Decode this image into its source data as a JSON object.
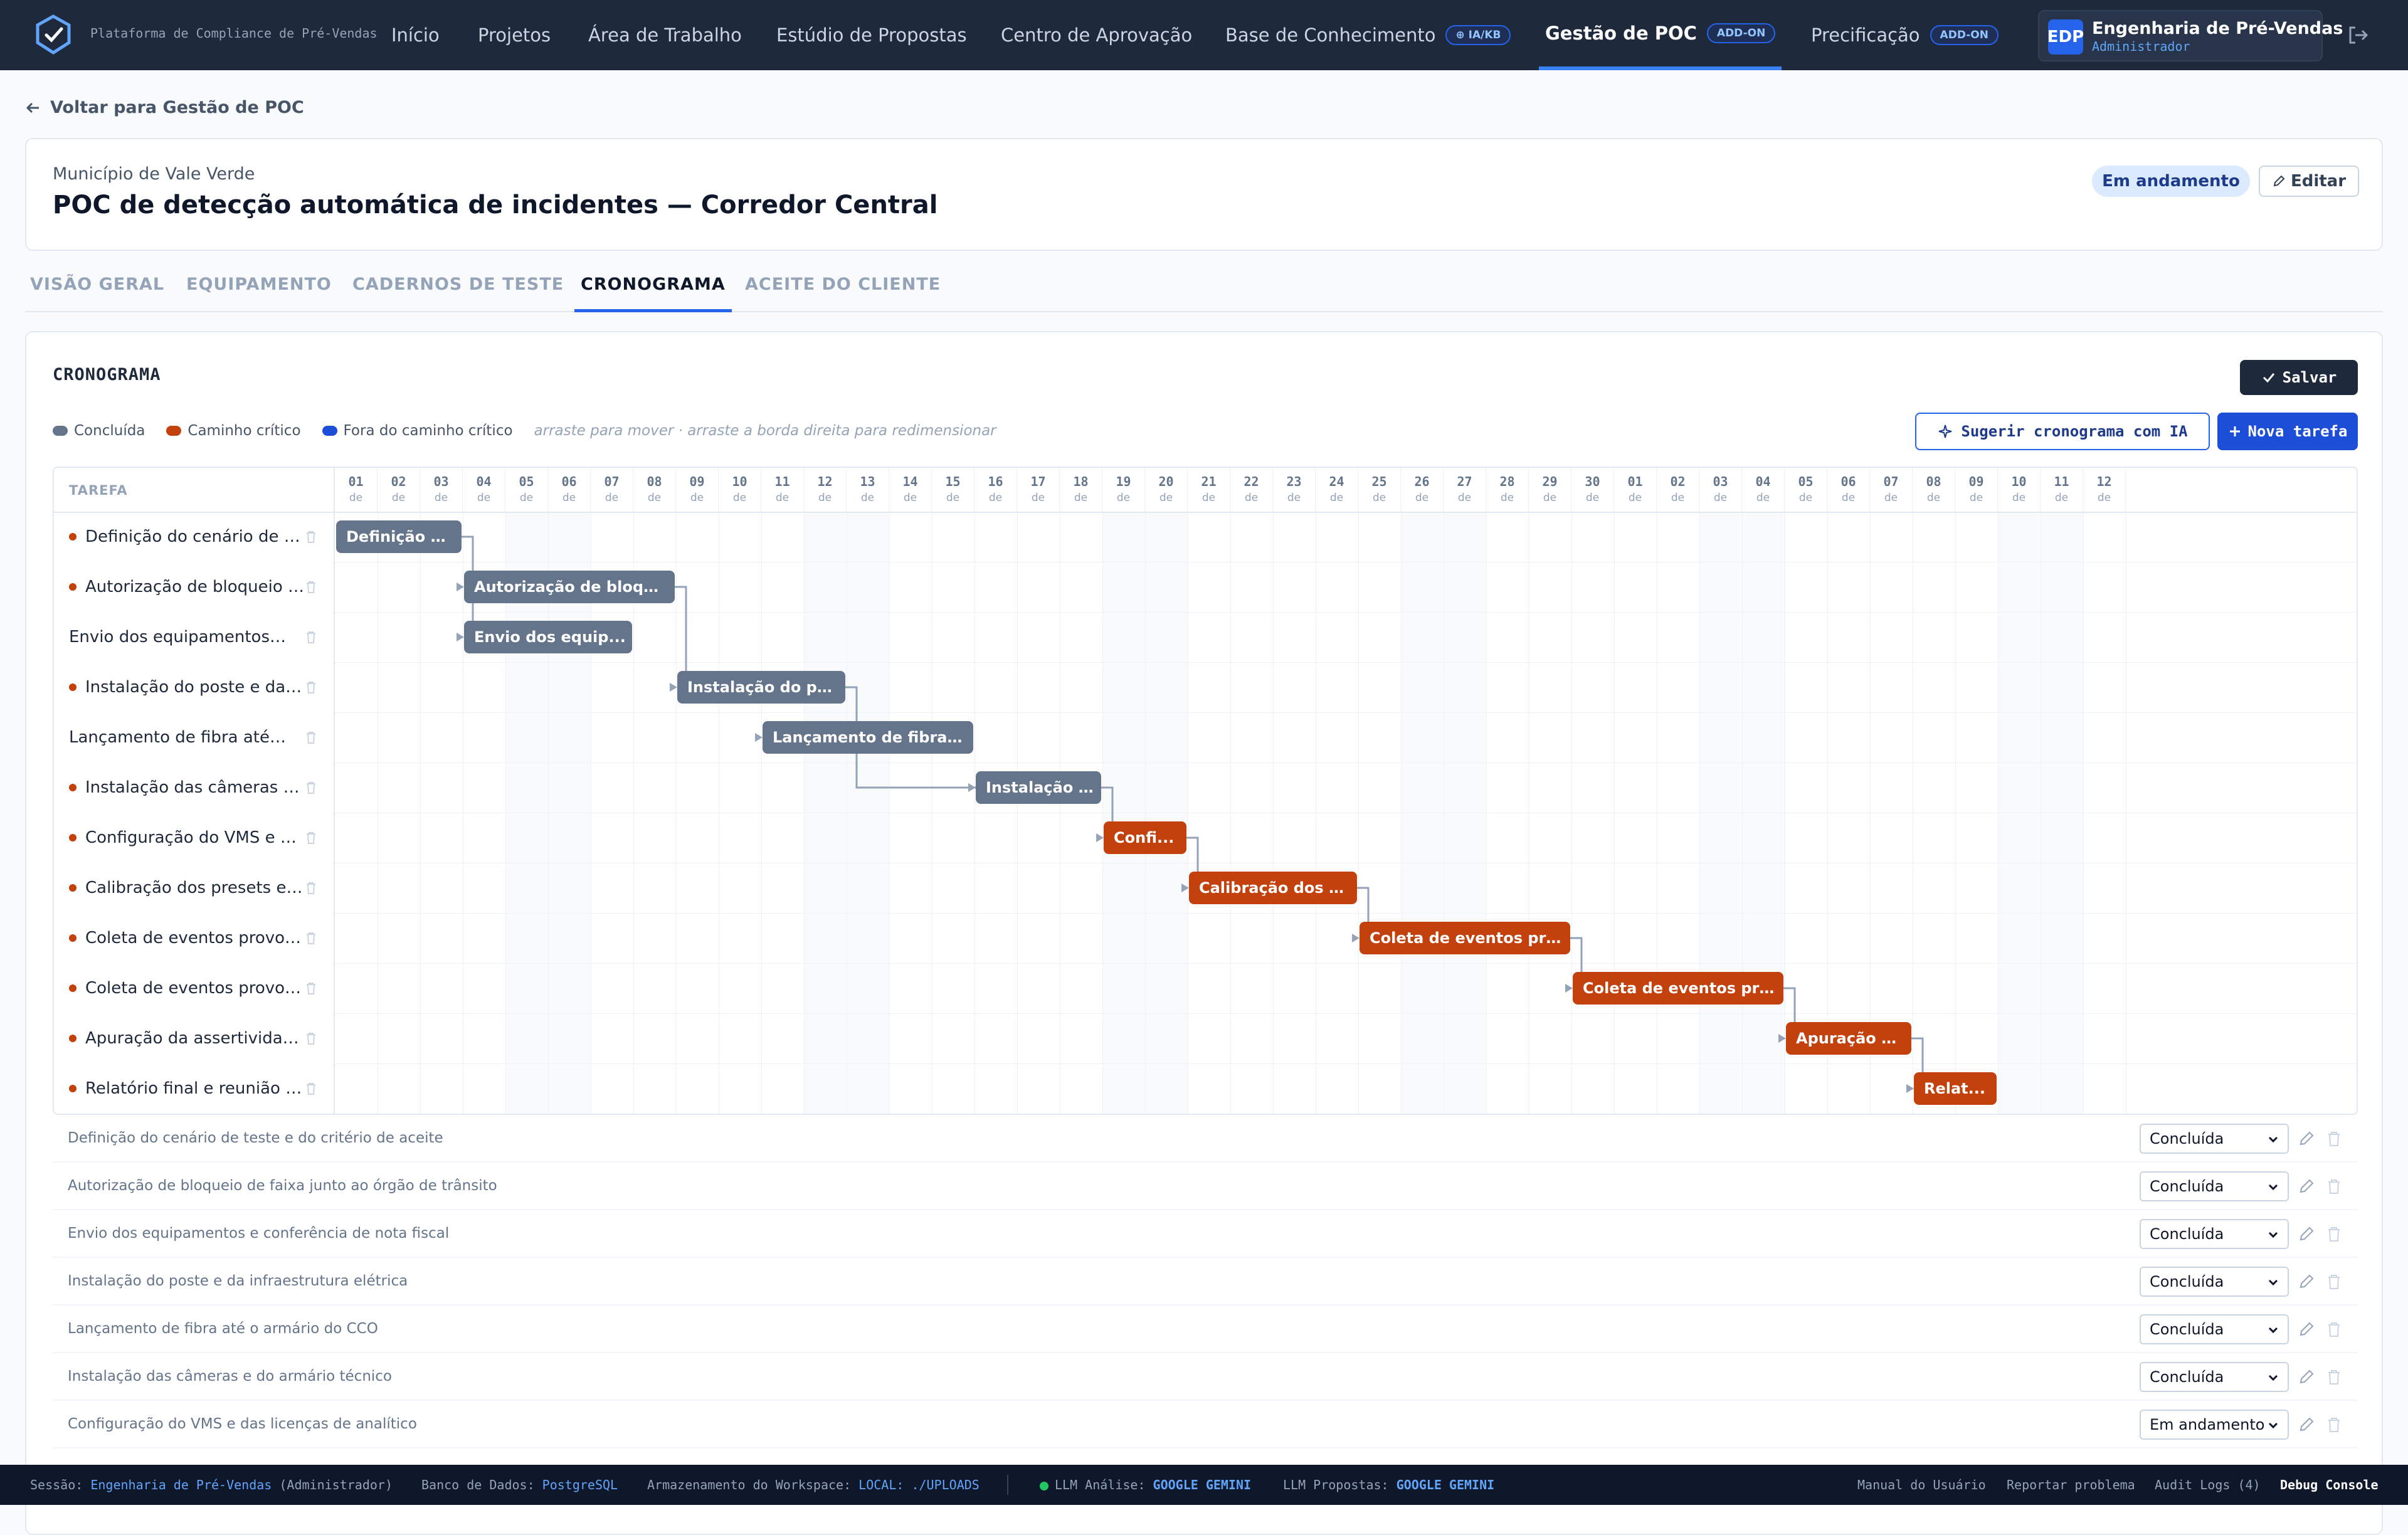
{
  "nav": {
    "brand": "Plataforma de Compliance de Pré-Vendas",
    "items": [
      {
        "label": "Início"
      },
      {
        "label": "Projetos"
      },
      {
        "label": "Área de Trabalho"
      },
      {
        "label": "Estúdio de Propostas"
      },
      {
        "label": "Centro de Aprovação"
      },
      {
        "label": "Base de Conhecimento",
        "badge": "IA/KB"
      },
      {
        "label": "Gestão de POC",
        "badge": "ADD-ON",
        "active": true
      },
      {
        "label": "Precificação",
        "badge": "ADD-ON"
      }
    ],
    "user": {
      "initials": "EDP",
      "name": "Engenharia de Pré-Vendas",
      "role": "Administrador"
    }
  },
  "back_link": "Voltar para Gestão de POC",
  "header": {
    "client": "Município de Vale Verde",
    "title": "POC de detecção automática de incidentes — Corredor Central",
    "status": "Em andamento",
    "edit_label": "Editar"
  },
  "tabs": [
    {
      "label": "VISÃO GERAL"
    },
    {
      "label": "EQUIPAMENTO"
    },
    {
      "label": "CADERNOS DE TESTE"
    },
    {
      "label": "CRONOGRAMA",
      "active": true
    },
    {
      "label": "ACEITE DO CLIENTE"
    }
  ],
  "schedule": {
    "title": "CRONOGRAMA",
    "save_label": "Salvar",
    "legend": [
      {
        "label": "Concluída",
        "color": "#64748b"
      },
      {
        "label": "Caminho crítico",
        "color": "#c2410c"
      },
      {
        "label": "Fora do caminho crítico",
        "color": "#1d4ed8"
      }
    ],
    "hint": "arraste para mover · arraste a borda direita para redimensionar",
    "ai_button": "Sugerir cronograma com IA",
    "new_button": "Nova tarefa",
    "column_header": "TAREFA",
    "day_suffix": "de",
    "days": [
      "01",
      "02",
      "03",
      "04",
      "05",
      "06",
      "07",
      "08",
      "09",
      "10",
      "11",
      "12",
      "13",
      "14",
      "15",
      "16",
      "17",
      "18",
      "19",
      "20",
      "21",
      "22",
      "23",
      "24",
      "25",
      "26",
      "27",
      "28",
      "29",
      "30",
      "01",
      "02",
      "03",
      "04",
      "05",
      "06",
      "07",
      "08",
      "09",
      "10",
      "11",
      "12"
    ],
    "weekend_columns": [
      4,
      5,
      11,
      12,
      18,
      19,
      25,
      26,
      32,
      33,
      39,
      40
    ],
    "tasks": [
      {
        "name": "Definição do cenário de teste e do critério de aceite",
        "bar": "Definição d...",
        "start": 0,
        "duration": 3,
        "critical_dot": true,
        "kind": "done"
      },
      {
        "name": "Autorização de bloqueio de faixa junto ao órgão de trânsito",
        "bar": "Autorização de bloqu...",
        "start": 3,
        "duration": 5,
        "critical_dot": true,
        "kind": "done"
      },
      {
        "name": "Envio dos equipamentos e conferência de nota fiscal",
        "bar": "Envio dos equip...",
        "start": 3,
        "duration": 4,
        "critical_dot": false,
        "kind": "done"
      },
      {
        "name": "Instalação do poste e da infraestrutura elétrica",
        "bar": "Instalação do po...",
        "start": 8,
        "duration": 4,
        "critical_dot": true,
        "kind": "done"
      },
      {
        "name": "Lançamento de fibra até o armário do CCO",
        "bar": "Lançamento de fibra a...",
        "start": 10,
        "duration": 5,
        "critical_dot": false,
        "kind": "done"
      },
      {
        "name": "Instalação das câmeras e do armário técnico",
        "bar": "Instalação ...",
        "start": 15,
        "duration": 3,
        "critical_dot": true,
        "kind": "done"
      },
      {
        "name": "Configuração do VMS e das licenças de analítico",
        "bar": "Confi...",
        "start": 18,
        "duration": 2,
        "critical_dot": true,
        "kind": "crit"
      },
      {
        "name": "Calibração dos presets e das zonas de detecção",
        "bar": "Calibração dos p...",
        "start": 20,
        "duration": 4,
        "critical_dot": true,
        "kind": "crit"
      },
      {
        "name": "Coleta de eventos provocados — rodada 1",
        "bar": "Coleta de eventos pro...",
        "start": 24,
        "duration": 5,
        "critical_dot": true,
        "kind": "crit"
      },
      {
        "name": "Coleta de eventos provocados — rodada 2",
        "bar": "Coleta de eventos pro...",
        "start": 29,
        "duration": 5,
        "critical_dot": true,
        "kind": "crit"
      },
      {
        "name": "Apuração da assertividade e dos falsos positivos",
        "bar": "Apuração d...",
        "start": 34,
        "duration": 3,
        "critical_dot": true,
        "kind": "crit"
      },
      {
        "name": "Relatório final e reunião de aceite",
        "bar": "Relat...",
        "start": 37,
        "duration": 2,
        "critical_dot": true,
        "kind": "crit"
      }
    ],
    "links": [
      [
        0,
        1
      ],
      [
        0,
        2
      ],
      [
        1,
        3
      ],
      [
        3,
        4
      ],
      [
        3,
        5
      ],
      [
        5,
        6
      ],
      [
        6,
        7
      ],
      [
        7,
        8
      ],
      [
        8,
        9
      ],
      [
        9,
        10
      ],
      [
        10,
        11
      ]
    ]
  },
  "task_list": [
    {
      "name": "Definição do cenário de teste e do critério de aceite",
      "status": "Concluída"
    },
    {
      "name": "Autorização de bloqueio de faixa junto ao órgão de trânsito",
      "status": "Concluída"
    },
    {
      "name": "Envio dos equipamentos e conferência de nota fiscal",
      "status": "Concluída"
    },
    {
      "name": "Instalação do poste e da infraestrutura elétrica",
      "status": "Concluída"
    },
    {
      "name": "Lançamento de fibra até o armário do CCO",
      "status": "Concluída"
    },
    {
      "name": "Instalação das câmeras e do armário técnico",
      "status": "Concluída"
    },
    {
      "name": "Configuração do VMS e das licenças de analítico",
      "status": "Em andamento"
    }
  ],
  "footer": {
    "session_label": "Sessão:",
    "session_user": "Engenharia de Pré-Vendas",
    "session_role": "(Administrador)",
    "db_label": "Banco de Dados:",
    "db_value": "PostgreSQL",
    "storage_label": "Armazenamento do Workspace:",
    "storage_value": "LOCAL: ./UPLOADS",
    "llm_analysis_label": "LLM Análise:",
    "llm_analysis_value": "GOOGLE GEMINI",
    "llm_proposals_label": "LLM Propostas:",
    "llm_proposals_value": "GOOGLE GEMINI",
    "manual": "Manual do Usuário",
    "report": "Reportar problema",
    "audit": "Audit Logs (4)",
    "debug": "Debug Console"
  }
}
